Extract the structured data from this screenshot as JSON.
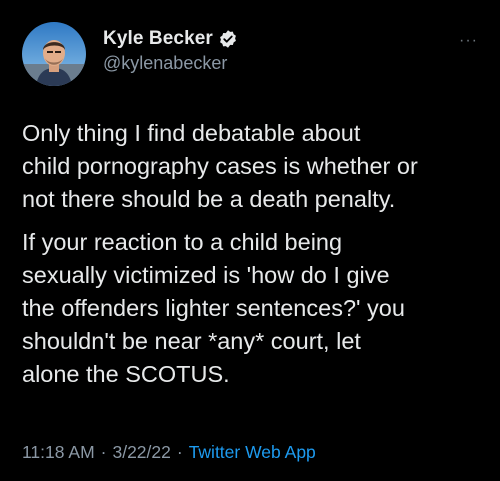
{
  "colors": {
    "background": "#000000",
    "text": "#e7e9ea",
    "secondary_text": "#8b98a5",
    "accent": "#1d9bf0"
  },
  "author": {
    "display_name": "Kyle Becker",
    "handle": "@kylenabecker",
    "verified_icon": "verified-badge-icon",
    "avatar_icon": "profile-avatar"
  },
  "more_menu": {
    "label": "···",
    "icon": "more-dots-icon"
  },
  "tweet": {
    "paragraphs": [
      "Only thing I find debatable about\nchild pornography cases is whether or\nnot there should be a death penalty.",
      "If your reaction to a child being\nsexually victimized is 'how do I give\nthe offenders lighter sentences?' you\nshouldn't be near *any* court, let\nalone the SCOTUS."
    ]
  },
  "meta": {
    "time": "11:18 AM",
    "date": "3/22/22",
    "separator": "·",
    "source": "Twitter Web App"
  }
}
